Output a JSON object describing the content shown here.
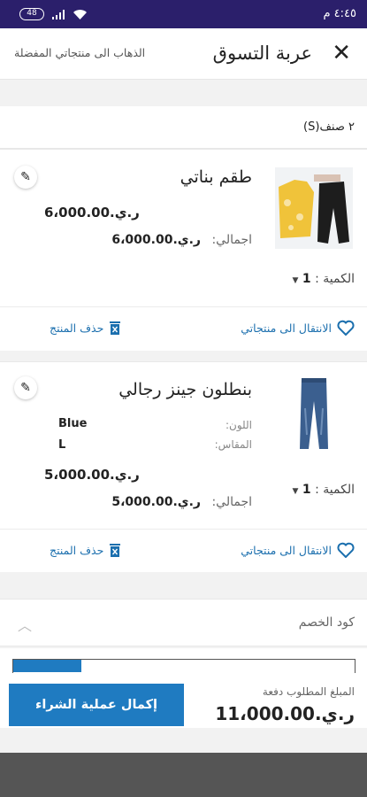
{
  "status_bar": {
    "time": "٤:٤٥ م",
    "battery": "48"
  },
  "header": {
    "title": "عربة التسوق",
    "favorites_link": "الذهاب الى منتجاتي المفضلة"
  },
  "cart": {
    "count_text": "٢ صنف(S)"
  },
  "items": [
    {
      "name": "طقم بناتي",
      "price": "ر.ي.6،000.00",
      "total_label": "اجمالي:",
      "total_value": "ر.ي.6،000.00",
      "qty_label": "الكمية :",
      "qty": "1",
      "move_label": "الانتقال الى منتجاتي",
      "delete_label": "حذف المنتج"
    },
    {
      "name": "بنطلون جينز رجالي",
      "color_label": "اللون:",
      "color_value": "Blue",
      "size_label": "المقاس:",
      "size_value": "L",
      "price": "ر.ي.5،000.00",
      "total_label": "اجمالي:",
      "total_value": "ر.ي.5،000.00",
      "qty_label": "الكمية :",
      "qty": "1",
      "move_label": "الانتقال الى منتجاتي",
      "delete_label": "حذف المنتج"
    }
  ],
  "coupon": {
    "label": "كود الخصم"
  },
  "footer": {
    "due_label": "المبلغ المطلوب دفعة",
    "due_value": "ر.ي.11،000.00",
    "checkout_label": "إكمال عملية الشراء",
    "progress": 0.2
  },
  "colors": {
    "accent": "#1f7bc1",
    "status_bar": "#2b1f6b",
    "link": "#1b6fae"
  }
}
